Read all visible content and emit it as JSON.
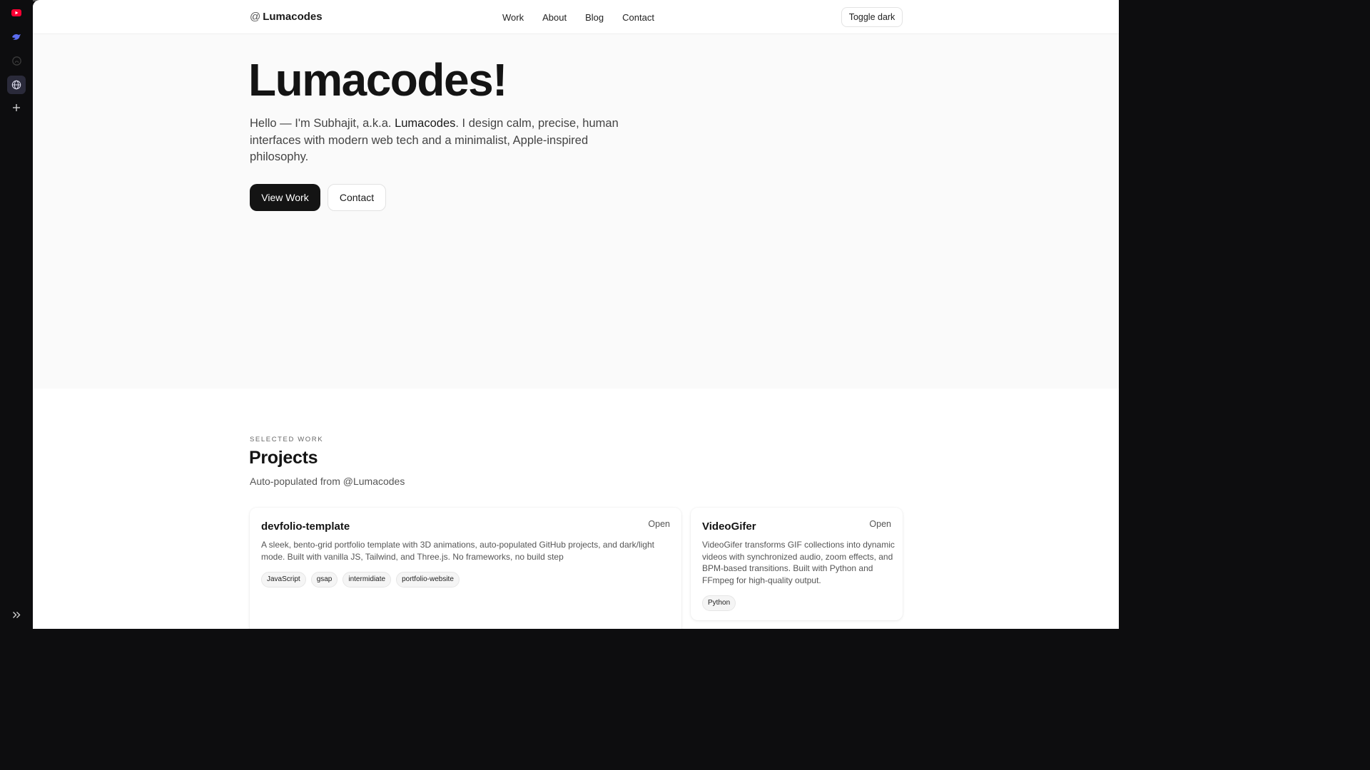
{
  "nav": {
    "brand_at": "@",
    "brand": "Lumacodes",
    "links": [
      "Work",
      "About",
      "Blog",
      "Contact"
    ],
    "toggle_label": "Toggle dark"
  },
  "hero": {
    "title": "Lumacodes!",
    "intro_before": "Hello — I'm Subhajit, a.k.a. ",
    "intro_name": "Lumacodes",
    "intro_after": ". I design calm, precise, human interfaces with modern web tech and a minimalist, Apple-inspired philosophy.",
    "primary_button": "View Work",
    "secondary_button": "Contact"
  },
  "projects": {
    "eyebrow": "SELECTED WORK",
    "title": "Projects",
    "subtitle": "Auto-populated from @Lumacodes",
    "items": [
      {
        "name": "devfolio-template",
        "open_label": "Open",
        "description": "A sleek, bento-grid portfolio template with 3D animations, auto-populated GitHub projects, and dark/light mode. Built with vanilla JS, Tailwind, and Three.js. No frameworks, no build step",
        "tags": [
          "JavaScript",
          "gsap",
          "intermidiate",
          "portfolio-website"
        ]
      },
      {
        "name": "VideoGifer",
        "open_label": "Open",
        "description": "VideoGifer transforms GIF collections into dynamic videos with synchronized audio, zoom effects, and BPM-based transitions. Built with Python and FFmpeg for high-quality output.",
        "tags": [
          "Python"
        ]
      }
    ]
  },
  "browser_sidebar": {
    "icons": [
      "youtube-icon",
      "bird-icon",
      "github-icon",
      "globe-icon",
      "plus-icon",
      "expand-icon"
    ],
    "colors": {
      "youtube": "#ff0033",
      "bird": "#5b6cf0",
      "active_bg": "#2a2a3a"
    }
  }
}
